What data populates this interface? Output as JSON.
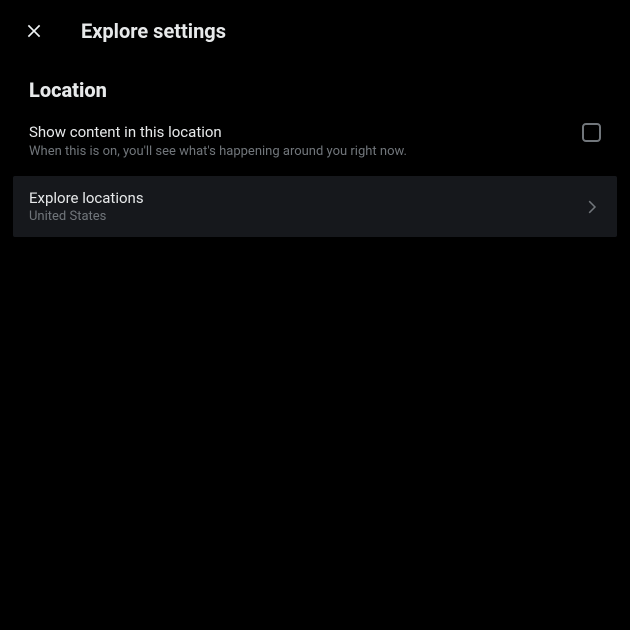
{
  "header": {
    "title": "Explore settings"
  },
  "section": {
    "title": "Location"
  },
  "show_content": {
    "label": "Show content in this location",
    "description": "When this is on, you'll see what's happening around you right now."
  },
  "explore_locations": {
    "label": "Explore locations",
    "value": "United States"
  }
}
